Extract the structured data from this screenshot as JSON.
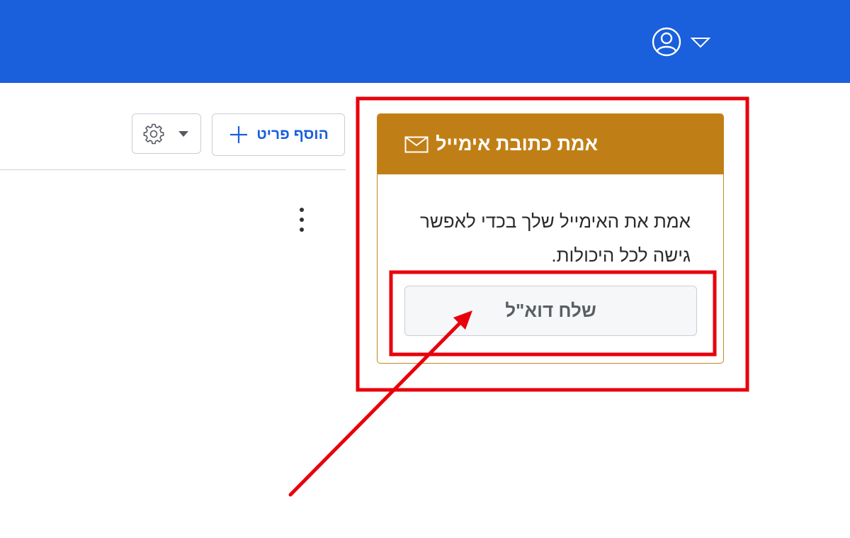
{
  "header": {
    "user_menu_icon": "user-circle-icon",
    "user_menu_caret": "caret-down-icon",
    "color": "#1a5fdc"
  },
  "toolbar": {
    "add_item_label": "הוסף פריט",
    "add_item_icon": "plus-icon",
    "settings_icon": "gear-icon",
    "settings_caret": "caret-down-icon",
    "more_options_icon": "kebab-icon"
  },
  "verify_email_card": {
    "title": "אמת כתובת אימייל",
    "title_icon": "envelope-icon",
    "message_line1": "אמת את האימייל שלך בכדי לאפשר",
    "message_line2": "גישה לכל היכולות.",
    "send_button_label": "שלח דוא\"ל",
    "header_color": "#c07f16"
  },
  "annotation": {
    "color": "#e8000b",
    "shapes": [
      "highlight-box-card",
      "highlight-box-send-button",
      "pointer-arrow"
    ]
  }
}
